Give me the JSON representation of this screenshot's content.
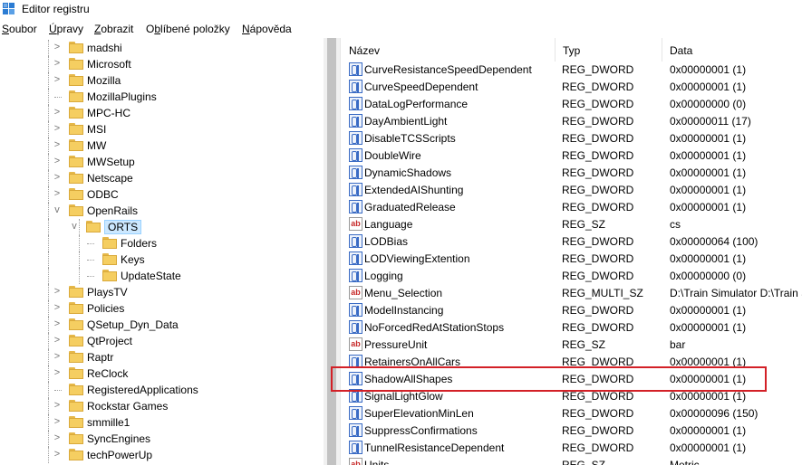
{
  "window": {
    "title": "Editor registru",
    "icon": "registry-editor-icon"
  },
  "menu": [
    {
      "pre": "",
      "ul": "S",
      "post": "oubor"
    },
    {
      "pre": "",
      "ul": "Ú",
      "post": "pravy"
    },
    {
      "pre": "",
      "ul": "Z",
      "post": "obrazit"
    },
    {
      "pre": "O",
      "ul": "b",
      "post": "líbené položky"
    },
    {
      "pre": "",
      "ul": "N",
      "post": "ápověda"
    }
  ],
  "tree": [
    {
      "label": "madshi",
      "expander": ">"
    },
    {
      "label": "Microsoft",
      "expander": ">"
    },
    {
      "label": "Mozilla",
      "expander": ">"
    },
    {
      "label": "MozillaPlugins",
      "expander": ""
    },
    {
      "label": "MPC-HC",
      "expander": ">"
    },
    {
      "label": "MSI",
      "expander": ">"
    },
    {
      "label": "MW",
      "expander": ">"
    },
    {
      "label": "MWSetup",
      "expander": ">"
    },
    {
      "label": "Netscape",
      "expander": ">"
    },
    {
      "label": "ODBC",
      "expander": ">"
    },
    {
      "label": "OpenRails",
      "expander": "v"
    },
    {
      "label": "ORTS",
      "expander": "v",
      "selected": true
    },
    {
      "label": "Folders",
      "expander": ""
    },
    {
      "label": "Keys",
      "expander": ""
    },
    {
      "label": "UpdateState",
      "expander": ""
    },
    {
      "label": "PlaysTV",
      "expander": ">"
    },
    {
      "label": "Policies",
      "expander": ">"
    },
    {
      "label": "QSetup_Dyn_Data",
      "expander": ">"
    },
    {
      "label": "QtProject",
      "expander": ">"
    },
    {
      "label": "Raptr",
      "expander": ">"
    },
    {
      "label": "ReClock",
      "expander": ">"
    },
    {
      "label": "RegisteredApplications",
      "expander": ""
    },
    {
      "label": "Rockstar Games",
      "expander": ">"
    },
    {
      "label": "smmille1",
      "expander": ">"
    },
    {
      "label": "SyncEngines",
      "expander": ">"
    },
    {
      "label": "techPowerUp",
      "expander": ">"
    }
  ],
  "columns": {
    "name": "Název",
    "type": "Typ",
    "data": "Data"
  },
  "values": [
    {
      "name": "CurveResistanceSpeedDependent",
      "type": "REG_DWORD",
      "data": "0x00000001 (1)",
      "icon": "binary-value-icon"
    },
    {
      "name": "CurveSpeedDependent",
      "type": "REG_DWORD",
      "data": "0x00000001 (1)",
      "icon": "binary-value-icon"
    },
    {
      "name": "DataLogPerformance",
      "type": "REG_DWORD",
      "data": "0x00000000 (0)",
      "icon": "binary-value-icon"
    },
    {
      "name": "DayAmbientLight",
      "type": "REG_DWORD",
      "data": "0x00000011 (17)",
      "icon": "binary-value-icon"
    },
    {
      "name": "DisableTCSScripts",
      "type": "REG_DWORD",
      "data": "0x00000001 (1)",
      "icon": "binary-value-icon"
    },
    {
      "name": "DoubleWire",
      "type": "REG_DWORD",
      "data": "0x00000001 (1)",
      "icon": "binary-value-icon"
    },
    {
      "name": "DynamicShadows",
      "type": "REG_DWORD",
      "data": "0x00000001 (1)",
      "icon": "binary-value-icon"
    },
    {
      "name": "ExtendedAIShunting",
      "type": "REG_DWORD",
      "data": "0x00000001 (1)",
      "icon": "binary-value-icon"
    },
    {
      "name": "GraduatedRelease",
      "type": "REG_DWORD",
      "data": "0x00000001 (1)",
      "icon": "binary-value-icon"
    },
    {
      "name": "Language",
      "type": "REG_SZ",
      "data": "cs",
      "icon": "string-value-icon"
    },
    {
      "name": "LODBias",
      "type": "REG_DWORD",
      "data": "0x00000064 (100)",
      "icon": "binary-value-icon"
    },
    {
      "name": "LODViewingExtention",
      "type": "REG_DWORD",
      "data": "0x00000001 (1)",
      "icon": "binary-value-icon"
    },
    {
      "name": "Logging",
      "type": "REG_DWORD",
      "data": "0x00000000 (0)",
      "icon": "binary-value-icon"
    },
    {
      "name": "Menu_Selection",
      "type": "REG_MULTI_SZ",
      "data": "D:\\Train Simulator D:\\Train Si",
      "icon": "string-value-icon"
    },
    {
      "name": "ModelInstancing",
      "type": "REG_DWORD",
      "data": "0x00000001 (1)",
      "icon": "binary-value-icon"
    },
    {
      "name": "NoForcedRedAtStationStops",
      "type": "REG_DWORD",
      "data": "0x00000001 (1)",
      "icon": "binary-value-icon"
    },
    {
      "name": "PressureUnit",
      "type": "REG_SZ",
      "data": "bar",
      "icon": "string-value-icon"
    },
    {
      "name": "RetainersOnAllCars",
      "type": "REG_DWORD",
      "data": "0x00000001 (1)",
      "icon": "binary-value-icon"
    },
    {
      "name": "ShadowAllShapes",
      "type": "REG_DWORD",
      "data": "0x00000001 (1)",
      "icon": "binary-value-icon",
      "highlighted": true
    },
    {
      "name": "SignalLightGlow",
      "type": "REG_DWORD",
      "data": "0x00000001 (1)",
      "icon": "binary-value-icon"
    },
    {
      "name": "SuperElevationMinLen",
      "type": "REG_DWORD",
      "data": "0x00000096 (150)",
      "icon": "binary-value-icon"
    },
    {
      "name": "SuppressConfirmations",
      "type": "REG_DWORD",
      "data": "0x00000001 (1)",
      "icon": "binary-value-icon"
    },
    {
      "name": "TunnelResistanceDependent",
      "type": "REG_DWORD",
      "data": "0x00000001 (1)",
      "icon": "binary-value-icon"
    },
    {
      "name": "Units",
      "type": "REG_SZ",
      "data": "Metric",
      "icon": "string-value-icon"
    }
  ],
  "colors": {
    "annotation_box": "#d32027",
    "selection": "#cce8ff",
    "folder": "#f5ce61"
  }
}
